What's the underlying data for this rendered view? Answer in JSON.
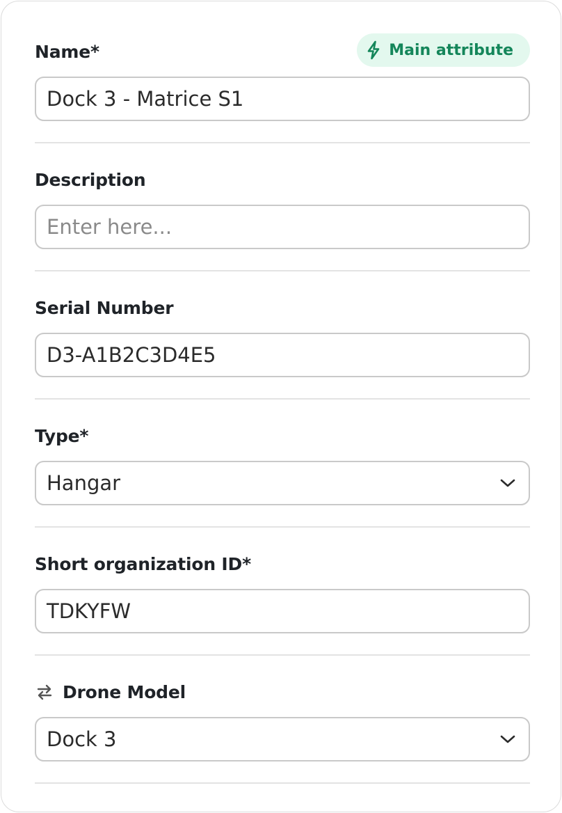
{
  "form": {
    "name": {
      "label": "Name*",
      "value": "Dock 3 - Matrice S1",
      "badge": {
        "label": "Main attribute",
        "icon": "lightning-bolt-icon",
        "color": "#14865a",
        "background": "#e3f8ee"
      }
    },
    "description": {
      "label": "Description",
      "value": "",
      "placeholder": "Enter here..."
    },
    "serial_number": {
      "label": "Serial Number",
      "value": "D3-A1B2C3D4E5"
    },
    "type": {
      "label": "Type*",
      "selected": "Hangar",
      "icon": "chevron-down-icon"
    },
    "short_org_id": {
      "label": "Short organization ID*",
      "value": "TDKYFW"
    },
    "drone_model": {
      "label": "Drone Model",
      "label_icon": "swap-arrows-icon",
      "selected": "Dock 3",
      "icon": "chevron-down-icon"
    }
  }
}
